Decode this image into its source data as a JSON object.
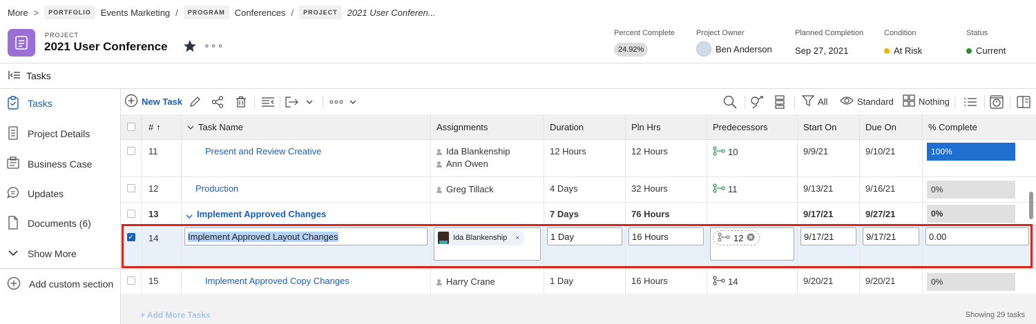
{
  "breadcrumb": {
    "more": "More",
    "more_sep": ">",
    "portfolio_badge": "PORTFOLIO",
    "portfolio_name": "Events Marketing",
    "program_badge": "PROGRAM",
    "program_name": "Conferences",
    "project_badge": "PROJECT",
    "project_name": "2021 User Conferen...",
    "sep": "/"
  },
  "project": {
    "kicker": "PROJECT",
    "title": "2021 User Conference",
    "more": "∘∘∘",
    "percent_complete_label": "Percent Complete",
    "percent_complete_value": "24.92%",
    "owner_label": "Project Owner",
    "owner_value": "Ben Anderson",
    "planned_completion_label": "Planned Completion",
    "planned_completion_value": "Sep 27, 2021",
    "condition_label": "Condition",
    "condition_value": "At Risk",
    "status_label": "Status",
    "status_value": "Current",
    "colors": {
      "at_risk": "#f0b400",
      "current": "#2e8b2e",
      "icon_bg": "#9a6fd6",
      "accent": "#1a5fb4"
    }
  },
  "tasks_bar": {
    "label": "Tasks"
  },
  "nav": {
    "items": [
      {
        "label": "Tasks",
        "icon": "clipboard-icon"
      },
      {
        "label": "Project Details",
        "icon": "document-icon"
      },
      {
        "label": "Business Case",
        "icon": "business-case-icon"
      },
      {
        "label": "Updates",
        "icon": "chat-icon"
      },
      {
        "label": "Documents (6)",
        "icon": "file-icon"
      },
      {
        "label": "Show More",
        "icon": "chevron-down-icon"
      }
    ],
    "add_custom": "Add custom section"
  },
  "toolbar": {
    "new_task": "New Task",
    "filter_all": "All",
    "view_standard": "Standard",
    "group_nothing": "Nothing"
  },
  "grid": {
    "headers": {
      "num": "#",
      "sort": "↑",
      "task_name": "Task Name",
      "assignments": "Assignments",
      "duration": "Duration",
      "pln_hrs": "Pln Hrs",
      "predecessors": "Predecessors",
      "start_on": "Start On",
      "due_on": "Due On",
      "pct_complete": "% Complete"
    },
    "rows": [
      {
        "num": "11",
        "name": "Present and Review Creative",
        "assign1": "Ida Blankenship",
        "assign2": "Ann Owen",
        "duration": "12 Hours",
        "plnhrs": "12 Hours",
        "pred": "10",
        "start": "9/9/21",
        "due": "9/10/21",
        "pct": "100%",
        "pct_value": 100
      },
      {
        "num": "12",
        "name": "Production",
        "assign1": "Greg Tillack",
        "duration": "4 Days",
        "plnhrs": "32 Hours",
        "pred": "11",
        "start": "9/13/21",
        "due": "9/16/21",
        "pct": "0%",
        "pct_value": 0
      },
      {
        "num": "13",
        "name": "Implement Approved Changes",
        "duration": "7 Days",
        "plnhrs": "76 Hours",
        "start": "9/17/21",
        "due": "9/27/21",
        "pct": "0%",
        "pct_value": 0
      },
      {
        "num": "14",
        "name": "Implement Approved Layout Changes",
        "assign1": "Ida Blankenship",
        "chip_remove": "×",
        "duration": "1 Day",
        "plnhrs": "16 Hours",
        "pred": "12",
        "start": "9/17/21",
        "due": "9/17/21",
        "pct": "0.00"
      },
      {
        "num": "15",
        "name": "Implement Approved Copy Changes",
        "assign1": "Harry Crane",
        "duration": "1 Day",
        "plnhrs": "16 Hours",
        "pred": "14",
        "start": "9/20/21",
        "due": "9/20/21",
        "pct": "0%",
        "pct_value": 0
      }
    ]
  },
  "footer": {
    "add_more": "+ Add More Tasks",
    "showing": "Showing 29 tasks"
  }
}
